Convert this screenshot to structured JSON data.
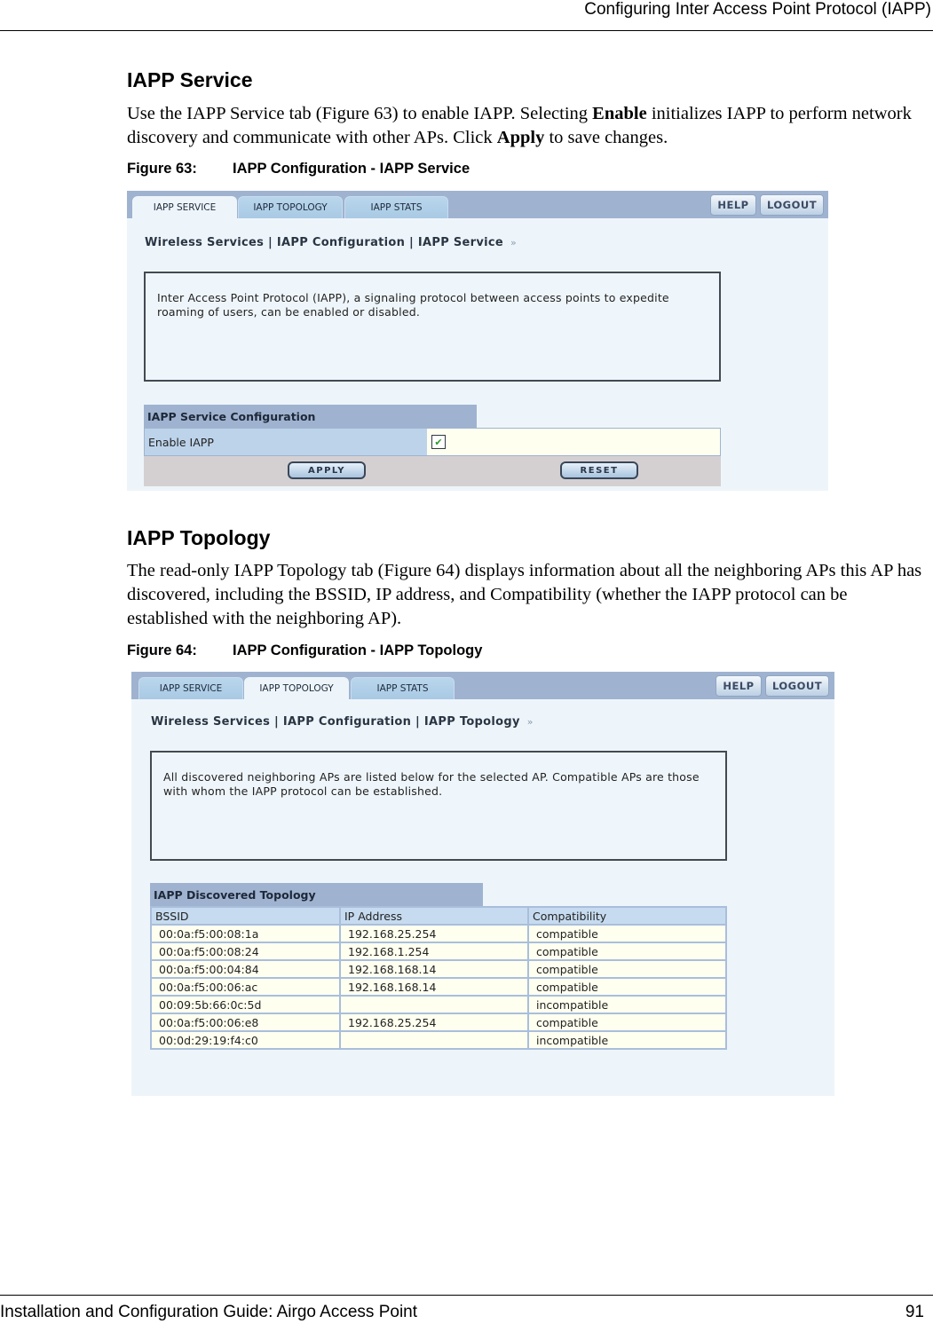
{
  "page_header": {
    "title": "Configuring Inter Access Point Protocol (IAPP)"
  },
  "page_footer": {
    "guide_title": "Installation and Configuration Guide: Airgo Access Point",
    "page_number": "91"
  },
  "section_service": {
    "heading": "IAPP Service",
    "paragraph": {
      "part1": "Use the IAPP Service tab (Figure 63) to enable IAPP. Selecting ",
      "bold1": "Enable",
      "part2": " initializes IAPP to perform network discovery and communicate with other APs. Click ",
      "bold2": "Apply",
      "part3": " to save changes."
    },
    "figure": {
      "number": "Figure 63:",
      "caption": "IAPP Configuration - IAPP Service"
    }
  },
  "section_topology": {
    "heading": "IAPP Topology",
    "paragraph": "The read-only IAPP Topology tab (Figure 64) displays information about all the neighboring APs this AP has discovered, including the BSSID, IP address, and Compatibility (whether the IAPP protocol can be established with the neighboring AP).",
    "figure": {
      "number": "Figure 64:",
      "caption": "IAPP Configuration - IAPP Topology"
    }
  },
  "ui": {
    "tabs": [
      "IAPP SERVICE",
      "IAPP TOPOLOGY",
      "IAPP STATS"
    ],
    "help_label": "HELP",
    "logout_label": "LOGOUT",
    "breadcrumb_arrows": "»",
    "colors": {
      "topbar": "#9fb3d0",
      "panel_bg": "#eef5fa",
      "value_bg": "#fffff0",
      "check": "#2f9a2f"
    }
  },
  "screen_service": {
    "active_tab": "IAPP SERVICE",
    "breadcrumb": "Wireless Services | IAPP Configuration | IAPP Service",
    "info_text": "Inter Access Point Protocol (IAPP), a signaling protocol between access points to expedite roaming of users, can be enabled or disabled.",
    "section_title": "IAPP Service Configuration",
    "enable_label": "Enable IAPP",
    "enable_checked": true,
    "check_glyph": "✔",
    "apply_label": "APPLY",
    "reset_label": "RESET"
  },
  "screen_topology": {
    "active_tab": "IAPP TOPOLOGY",
    "breadcrumb": "Wireless Services | IAPP Configuration | IAPP Topology",
    "info_text": "All discovered neighboring APs are listed below for the selected AP. Compatible APs are those with whom the IAPP protocol can be established.",
    "section_title": "IAPP Discovered Topology",
    "columns": [
      "BSSID",
      "IP Address",
      "Compatibility"
    ],
    "rows": [
      [
        "00:0a:f5:00:08:1a",
        "192.168.25.254",
        "compatible"
      ],
      [
        "00:0a:f5:00:08:24",
        "192.168.1.254",
        "compatible"
      ],
      [
        "00:0a:f5:00:04:84",
        "192.168.168.14",
        "compatible"
      ],
      [
        "00:0a:f5:00:06:ac",
        "192.168.168.14",
        "compatible"
      ],
      [
        "00:09:5b:66:0c:5d",
        "",
        "incompatible"
      ],
      [
        "00:0a:f5:00:06:e8",
        "192.168.25.254",
        "compatible"
      ],
      [
        "00:0d:29:19:f4:c0",
        "",
        "incompatible"
      ]
    ]
  }
}
